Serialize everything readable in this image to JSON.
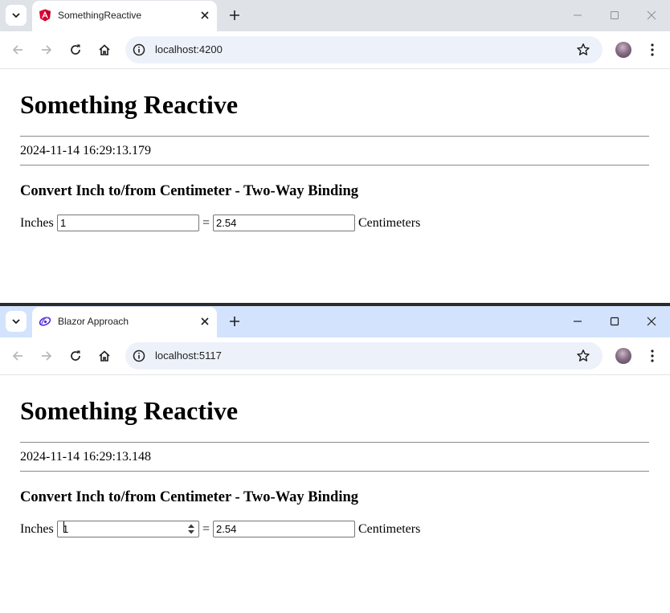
{
  "windows": [
    {
      "tab_title": "SomethingReactive",
      "favicon": "angular-icon",
      "url": "localhost:4200",
      "heading": "Something Reactive",
      "timestamp": "2024-11-14 16:29:13.179",
      "subheading": "Convert Inch to/from Centimeter - Two-Way Binding",
      "inches_label": "Inches",
      "inches_value": "1",
      "equals": "=",
      "cm_value": "2.54",
      "cm_label": "Centimeters",
      "tabbar_color": "#dfe3e8"
    },
    {
      "tab_title": "Blazor Approach",
      "favicon": "blazor-icon",
      "url": "localhost:5117",
      "heading": "Something Reactive",
      "timestamp": "2024-11-14 16:29:13.148",
      "subheading": "Convert Inch to/from Centimeter - Two-Way Binding",
      "inches_label": "Inches",
      "inches_value": "1",
      "equals": "=",
      "cm_value": "2.54",
      "cm_label": "Centimeters",
      "tabbar_color": "#d3e3fd"
    }
  ],
  "colors": {
    "angular_red": "#dd0031",
    "blazor_purple": "#512bd4",
    "omnibox": "#edf2fa"
  }
}
